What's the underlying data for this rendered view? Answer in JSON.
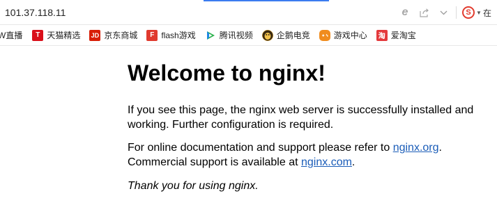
{
  "browser": {
    "url": "101.37.118.11",
    "toolbar_icons": {
      "compat": "e",
      "share": "share-icon",
      "dropdown": "chevron-down-icon",
      "sogou": "S",
      "zai": "在"
    }
  },
  "bookmarks": [
    {
      "label": "W直播",
      "icon": "live-icon"
    },
    {
      "label": "天猫精选",
      "icon": "tmall-icon",
      "glyph": "T"
    },
    {
      "label": "京东商城",
      "icon": "jd-icon",
      "glyph": "JD"
    },
    {
      "label": "flash游戏",
      "icon": "flash-game-icon",
      "glyph": "F"
    },
    {
      "label": "腾讯视频",
      "icon": "tencent-video-icon"
    },
    {
      "label": "企鹅电竞",
      "icon": "penguin-esports-icon"
    },
    {
      "label": "游戏中心",
      "icon": "game-center-icon"
    },
    {
      "label": "爱淘宝",
      "icon": "taobao-icon",
      "glyph": "淘"
    }
  ],
  "page": {
    "title": "Welcome to nginx!",
    "p1": "If you see this page, the nginx web server is successfully installed and working. Further configuration is required.",
    "p2_before": "For online documentation and support please refer to ",
    "p2_link1": "nginx.org",
    "p2_mid": ".",
    "p2_line2": "Commercial support is available at ",
    "p2_link2": "nginx.com",
    "p2_end": ".",
    "p3": "Thank you for using nginx."
  },
  "colors": {
    "link": "#1a5cb8",
    "progress": "#3b7cf0",
    "sogou": "#e23b2e"
  }
}
